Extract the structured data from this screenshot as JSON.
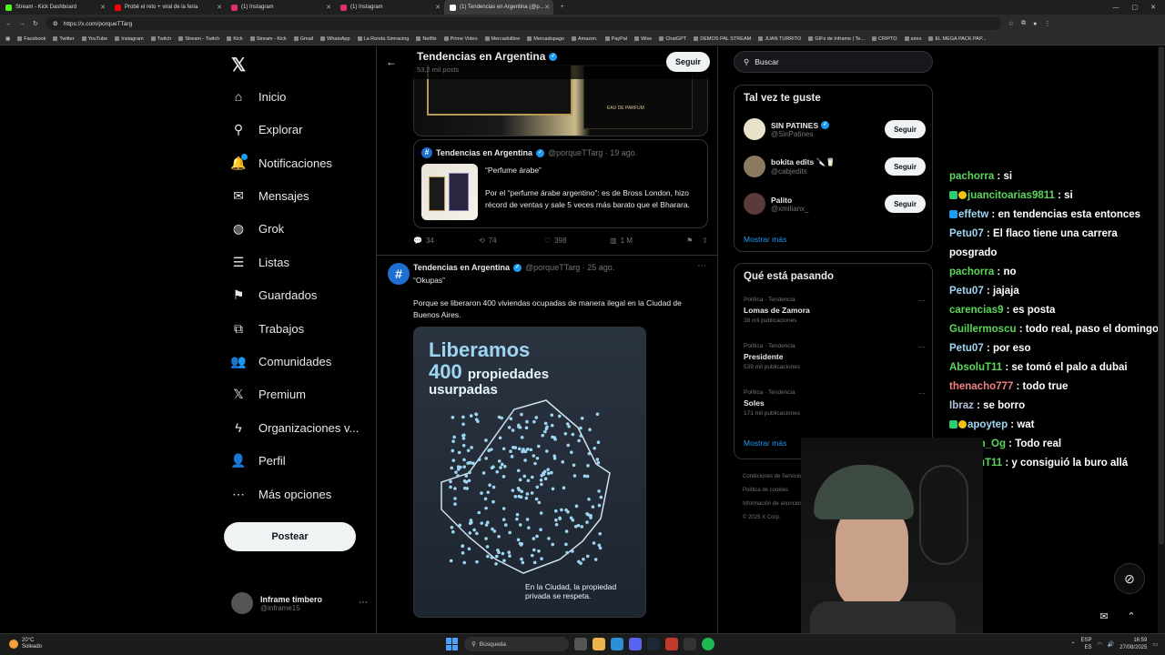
{
  "browser": {
    "tabs": [
      {
        "label": "Stream - Kick Dashboard",
        "color": "#53fc18"
      },
      {
        "label": "Probé el reto + viral de la feria",
        "color": "#ff0000"
      },
      {
        "label": "(1) Instagram",
        "color": "#e1306c"
      },
      {
        "label": "(1) Instagram",
        "color": "#e1306c"
      },
      {
        "label": "(1) Tendencias en Argentina (@p...",
        "color": "#ffffff"
      }
    ],
    "url": "https://x.com/porqueTTarg",
    "bookmarks": [
      "Facebook",
      "Twitter",
      "YouTube",
      "Instagram",
      "Twitch",
      "Stream - Twitch",
      "Kick",
      "Stream - Kick",
      "Gmail",
      "WhatsApp",
      "La Ronda Simracing",
      "Netflix",
      "Prime Video",
      "Mercadolibre",
      "Mercadopago",
      "Amazon.",
      "PayPal",
      "Wise",
      "ChatGPT",
      "DEMOS PAL STREAM",
      "JUAN TURRITO",
      "GIFs de Inframe | Te...",
      "CRIPTO",
      "aires",
      "EL MEGA PACK PAP..."
    ]
  },
  "nav": {
    "items": [
      {
        "label": "Inicio",
        "icon": "home-icon",
        "glyph": "⌂"
      },
      {
        "label": "Explorar",
        "icon": "search-icon",
        "glyph": "⚲"
      },
      {
        "label": "Notificaciones",
        "icon": "bell-icon",
        "glyph": "🔔"
      },
      {
        "label": "Mensajes",
        "icon": "mail-icon",
        "glyph": "✉"
      },
      {
        "label": "Grok",
        "icon": "grok-icon",
        "glyph": "◍"
      },
      {
        "label": "Listas",
        "icon": "list-icon",
        "glyph": "☰"
      },
      {
        "label": "Guardados",
        "icon": "bookmark-icon",
        "glyph": "⚑"
      },
      {
        "label": "Trabajos",
        "icon": "briefcase-icon",
        "glyph": "⧉"
      },
      {
        "label": "Comunidades",
        "icon": "people-icon",
        "glyph": "👥"
      },
      {
        "label": "Premium",
        "icon": "x-icon",
        "glyph": "𝕏"
      },
      {
        "label": "Organizaciones v...",
        "icon": "lightning-icon",
        "glyph": "ϟ"
      },
      {
        "label": "Perfil",
        "icon": "person-icon",
        "glyph": "👤"
      },
      {
        "label": "Más opciones",
        "icon": "more-icon",
        "glyph": "⋯"
      }
    ],
    "post_button": "Postear",
    "user_name": "Inframe timbero",
    "user_handle": "@inframe15"
  },
  "feed": {
    "title": "Tendencias en Argentina",
    "subtitle": "53,2 mil posts",
    "follow": "Seguir",
    "product_label": "EAU DE PARFUM",
    "quote": {
      "name": "Tendencias en Argentina",
      "handle": "@porqueTTarg · 19 ago.",
      "title": "“Perfume árabe”",
      "text": "Por el “perfume árabe argentino”: es de Bross London, hizo récord de ventas y sale 5 veces más barato que el Bharara."
    },
    "actions": {
      "replies": "34",
      "reposts": "74",
      "likes": "398",
      "views": "1 M"
    },
    "post2": {
      "name": "Tendencias en Argentina",
      "handle": "@porqueTTarg · 25 ago.",
      "title": "“Okupas”",
      "text": "Porque se liberaron 400 viviendas ocupadas de manera ilegal en la Ciudad de Buenos Aires.",
      "img_line1": "Liberamos",
      "img_num": "400",
      "img_line2": "propiedades",
      "img_line3": "usurpadas",
      "img_caption1": "En la Ciudad, la propiedad",
      "img_caption2": "privada se respeta."
    }
  },
  "sidebar": {
    "search_placeholder": "Buscar",
    "suggest_title": "Tal vez te guste",
    "suggestions": [
      {
        "name": "SIN PATINES",
        "handle": "@SinPatines",
        "follow": "Seguir"
      },
      {
        "name": "bokita edits 🔪🥛",
        "handle": "@cabjedits",
        "follow": "Seguir"
      },
      {
        "name": "Palito",
        "handle": "@xmilianx_",
        "follow": "Seguir"
      }
    ],
    "show_more": "Mostrar más",
    "trends_title": "Qué está pasando",
    "trends": [
      {
        "cat": "Política · Tendencia",
        "topic": "Lomas de Zamora",
        "posts": "38 mil publicaciones"
      },
      {
        "cat": "Política · Tendencia",
        "topic": "Presidente",
        "posts": "539 mil publicaciones"
      },
      {
        "cat": "Política · Tendencia",
        "topic": "Soles",
        "posts": "171 mil publicaciones"
      }
    ],
    "show_more2": "Mostrar más",
    "footer": [
      "Condiciones de Servicio",
      "Política de cookies",
      "Información de anuncios · Más",
      "© 2025 X Corp."
    ]
  },
  "chat": [
    {
      "user": "pachorra",
      "text": "si",
      "color": "#5cd65c"
    },
    {
      "user": "juancitoarias9811",
      "text": "si",
      "color": "#5cd65c"
    },
    {
      "user": "effetw",
      "text": "en tendencias esta entonces",
      "color": "#9ed6f2"
    },
    {
      "user": "Petu07",
      "text": "El flaco tiene una carrera posgrado",
      "color": "#9ed6f2"
    },
    {
      "user": "pachorra",
      "text": "no",
      "color": "#5cd65c"
    },
    {
      "user": "Petu07",
      "text": "jajaja",
      "color": "#9ed6f2"
    },
    {
      "user": "carencias9",
      "text": "es posta",
      "color": "#5cd65c"
    },
    {
      "user": "Guillermoscu",
      "text": "todo real, paso el domingo",
      "color": "#5cd65c"
    },
    {
      "user": "Petu07",
      "text": "por eso",
      "color": "#9ed6f2"
    },
    {
      "user": "AbsoluT11",
      "text": "se tomó el palo a dubai",
      "color": "#5cd65c"
    },
    {
      "user": "thenacho777",
      "text": "todo true",
      "color": "#f08080"
    },
    {
      "user": "Ibraz",
      "text": "se borro",
      "color": "#b0c4de"
    },
    {
      "user": "apoytep",
      "text": "wat",
      "color": "#9ed6f2"
    },
    {
      "user": "Clinton_Og",
      "text": "Todo real",
      "color": "#5cd65c"
    },
    {
      "user": "AbsoluT11",
      "text": "y consiguió la buro allá",
      "color": "#5cd65c"
    }
  ],
  "taskbar": {
    "temp": "20°C",
    "weather": "Soleado",
    "search": "Búsqueda",
    "lang1": "ESP",
    "lang2": "ES",
    "time": "16:59",
    "date": "27/08/2025"
  }
}
